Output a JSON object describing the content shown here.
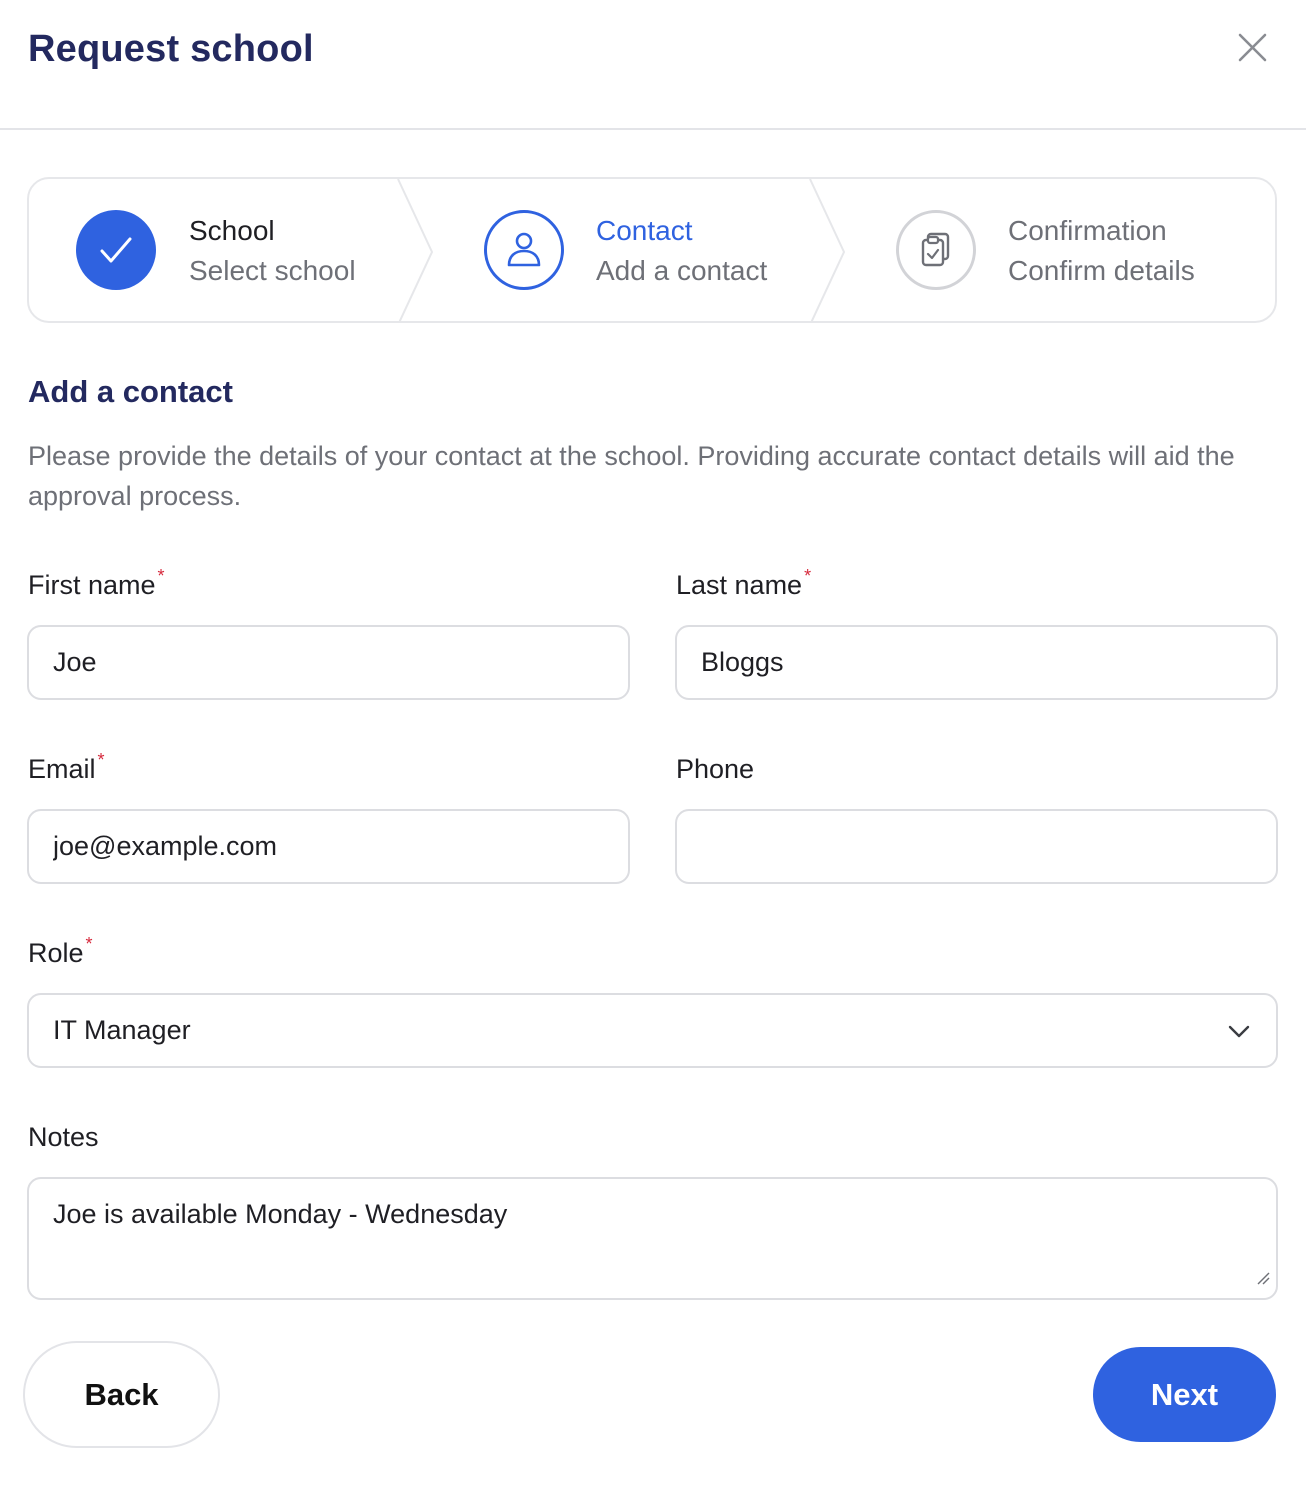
{
  "dialog": {
    "title": "Request school",
    "close_icon": "close-icon"
  },
  "stepper": {
    "steps": [
      {
        "title": "School",
        "subtitle": "Select school",
        "state": "completed",
        "icon": "check-icon"
      },
      {
        "title": "Contact",
        "subtitle": "Add a contact",
        "state": "active",
        "icon": "person-icon"
      },
      {
        "title": "Confirmation",
        "subtitle": "Confirm details",
        "state": "pending",
        "icon": "clipboard-check-icon"
      }
    ]
  },
  "section": {
    "title": "Add a contact",
    "description": "Please provide the details of your contact at the school. Providing accurate contact details will aid the approval process."
  },
  "form": {
    "required_marker": "*",
    "first_name": {
      "label": "First name",
      "value": "Joe",
      "required": true
    },
    "last_name": {
      "label": "Last name",
      "value": "Bloggs",
      "required": true
    },
    "email": {
      "label": "Email",
      "value": "joe@example.com",
      "required": true
    },
    "phone": {
      "label": "Phone",
      "value": "",
      "required": false
    },
    "role": {
      "label": "Role",
      "value": "IT Manager",
      "required": true
    },
    "notes": {
      "label": "Notes",
      "value": "Joe is available Monday - Wednesday",
      "required": false
    }
  },
  "actions": {
    "back_label": "Back",
    "next_label": "Next"
  },
  "colors": {
    "primary": "#2f62e0",
    "heading": "#23295f",
    "muted_text": "#6e7077",
    "required": "#d6293c",
    "border": "#dcdde1"
  }
}
